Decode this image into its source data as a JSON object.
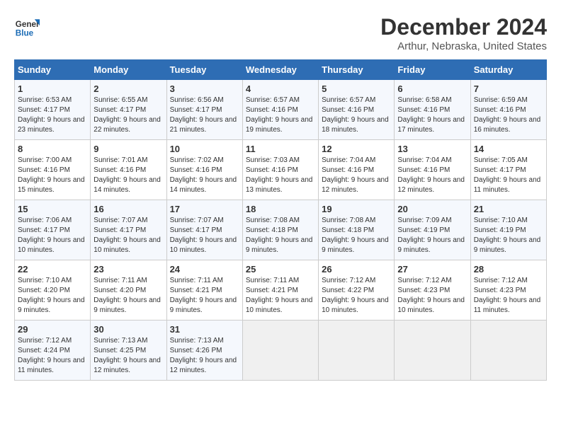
{
  "logo": {
    "line1": "General",
    "line2": "Blue"
  },
  "title": "December 2024",
  "subtitle": "Arthur, Nebraska, United States",
  "headers": [
    "Sunday",
    "Monday",
    "Tuesday",
    "Wednesday",
    "Thursday",
    "Friday",
    "Saturday"
  ],
  "weeks": [
    [
      {
        "day": "1",
        "sunrise": "6:53 AM",
        "sunset": "4:17 PM",
        "daylight": "9 hours and 23 minutes."
      },
      {
        "day": "2",
        "sunrise": "6:55 AM",
        "sunset": "4:17 PM",
        "daylight": "9 hours and 22 minutes."
      },
      {
        "day": "3",
        "sunrise": "6:56 AM",
        "sunset": "4:17 PM",
        "daylight": "9 hours and 21 minutes."
      },
      {
        "day": "4",
        "sunrise": "6:57 AM",
        "sunset": "4:16 PM",
        "daylight": "9 hours and 19 minutes."
      },
      {
        "day": "5",
        "sunrise": "6:57 AM",
        "sunset": "4:16 PM",
        "daylight": "9 hours and 18 minutes."
      },
      {
        "day": "6",
        "sunrise": "6:58 AM",
        "sunset": "4:16 PM",
        "daylight": "9 hours and 17 minutes."
      },
      {
        "day": "7",
        "sunrise": "6:59 AM",
        "sunset": "4:16 PM",
        "daylight": "9 hours and 16 minutes."
      }
    ],
    [
      {
        "day": "8",
        "sunrise": "7:00 AM",
        "sunset": "4:16 PM",
        "daylight": "9 hours and 15 minutes."
      },
      {
        "day": "9",
        "sunrise": "7:01 AM",
        "sunset": "4:16 PM",
        "daylight": "9 hours and 14 minutes."
      },
      {
        "day": "10",
        "sunrise": "7:02 AM",
        "sunset": "4:16 PM",
        "daylight": "9 hours and 14 minutes."
      },
      {
        "day": "11",
        "sunrise": "7:03 AM",
        "sunset": "4:16 PM",
        "daylight": "9 hours and 13 minutes."
      },
      {
        "day": "12",
        "sunrise": "7:04 AM",
        "sunset": "4:16 PM",
        "daylight": "9 hours and 12 minutes."
      },
      {
        "day": "13",
        "sunrise": "7:04 AM",
        "sunset": "4:16 PM",
        "daylight": "9 hours and 12 minutes."
      },
      {
        "day": "14",
        "sunrise": "7:05 AM",
        "sunset": "4:17 PM",
        "daylight": "9 hours and 11 minutes."
      }
    ],
    [
      {
        "day": "15",
        "sunrise": "7:06 AM",
        "sunset": "4:17 PM",
        "daylight": "9 hours and 10 minutes."
      },
      {
        "day": "16",
        "sunrise": "7:07 AM",
        "sunset": "4:17 PM",
        "daylight": "9 hours and 10 minutes."
      },
      {
        "day": "17",
        "sunrise": "7:07 AM",
        "sunset": "4:17 PM",
        "daylight": "9 hours and 10 minutes."
      },
      {
        "day": "18",
        "sunrise": "7:08 AM",
        "sunset": "4:18 PM",
        "daylight": "9 hours and 9 minutes."
      },
      {
        "day": "19",
        "sunrise": "7:08 AM",
        "sunset": "4:18 PM",
        "daylight": "9 hours and 9 minutes."
      },
      {
        "day": "20",
        "sunrise": "7:09 AM",
        "sunset": "4:19 PM",
        "daylight": "9 hours and 9 minutes."
      },
      {
        "day": "21",
        "sunrise": "7:10 AM",
        "sunset": "4:19 PM",
        "daylight": "9 hours and 9 minutes."
      }
    ],
    [
      {
        "day": "22",
        "sunrise": "7:10 AM",
        "sunset": "4:20 PM",
        "daylight": "9 hours and 9 minutes."
      },
      {
        "day": "23",
        "sunrise": "7:11 AM",
        "sunset": "4:20 PM",
        "daylight": "9 hours and 9 minutes."
      },
      {
        "day": "24",
        "sunrise": "7:11 AM",
        "sunset": "4:21 PM",
        "daylight": "9 hours and 9 minutes."
      },
      {
        "day": "25",
        "sunrise": "7:11 AM",
        "sunset": "4:21 PM",
        "daylight": "9 hours and 10 minutes."
      },
      {
        "day": "26",
        "sunrise": "7:12 AM",
        "sunset": "4:22 PM",
        "daylight": "9 hours and 10 minutes."
      },
      {
        "day": "27",
        "sunrise": "7:12 AM",
        "sunset": "4:23 PM",
        "daylight": "9 hours and 10 minutes."
      },
      {
        "day": "28",
        "sunrise": "7:12 AM",
        "sunset": "4:23 PM",
        "daylight": "9 hours and 11 minutes."
      }
    ],
    [
      {
        "day": "29",
        "sunrise": "7:12 AM",
        "sunset": "4:24 PM",
        "daylight": "9 hours and 11 minutes."
      },
      {
        "day": "30",
        "sunrise": "7:13 AM",
        "sunset": "4:25 PM",
        "daylight": "9 hours and 12 minutes."
      },
      {
        "day": "31",
        "sunrise": "7:13 AM",
        "sunset": "4:26 PM",
        "daylight": "9 hours and 12 minutes."
      },
      null,
      null,
      null,
      null
    ]
  ],
  "labels": {
    "sunrise": "Sunrise:",
    "sunset": "Sunset:",
    "daylight": "Daylight:"
  }
}
